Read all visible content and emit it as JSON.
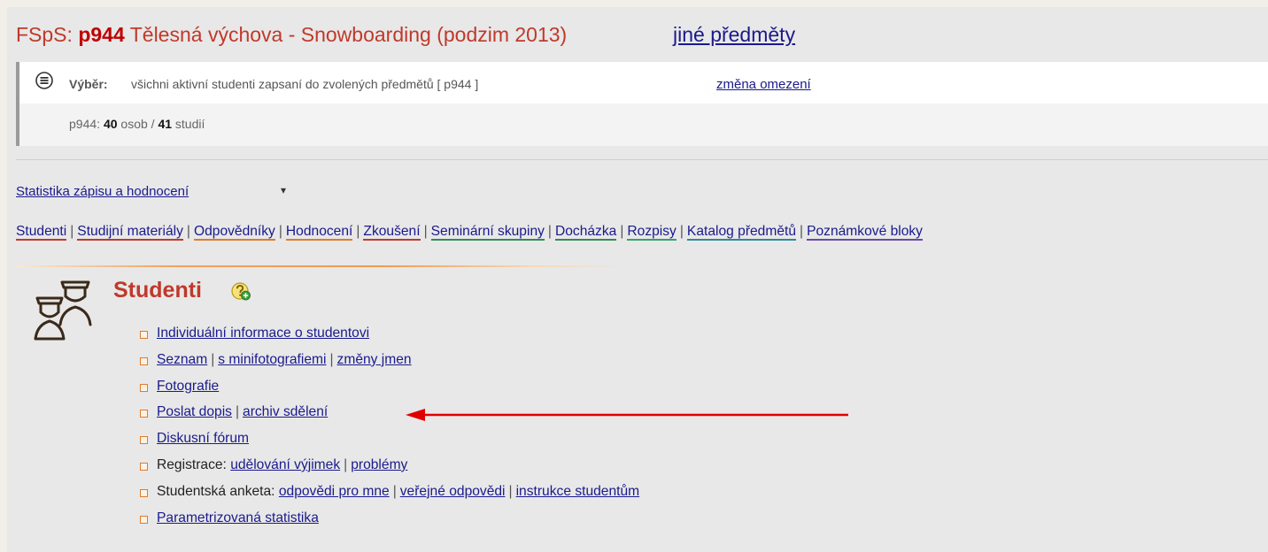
{
  "header": {
    "prefix": "FSpS: ",
    "course_code": "p944",
    "course_title": " Tělesná výchova - Snowboarding (podzim 2013)",
    "other_courses_link": "jiné předměty"
  },
  "selection": {
    "label": "Výběr:",
    "text": "všichni aktivní studenti zapsaní do zvolených předmětů [ p944 ]",
    "change_link": "změna omezení",
    "count_prefix": "p944: ",
    "persons": "40",
    "persons_label": " osob / ",
    "studies": "41",
    "studies_label": " studií"
  },
  "stats_link": "Statistika zápisu a hodnocení",
  "stats_caret": "▾",
  "nav": [
    {
      "label": "Studenti",
      "color": "#c0392b"
    },
    {
      "label": "Studijní materiály",
      "color": "#c0392b"
    },
    {
      "label": "Odpovědníky",
      "color": "#e07b2b"
    },
    {
      "label": "Hodnocení",
      "color": "#e07b2b"
    },
    {
      "label": "Zkoušení",
      "color": "#c0392b"
    },
    {
      "label": "Seminární skupiny",
      "color": "#2e8b57"
    },
    {
      "label": "Docházka",
      "color": "#2e8b57"
    },
    {
      "label": "Rozpisy",
      "color": "#33a36a"
    },
    {
      "label": "Katalog předmětů",
      "color": "#2a8a9a"
    },
    {
      "label": "Poznámkové bloky",
      "color": "#6a4aa0"
    }
  ],
  "section": {
    "title": "Studenti",
    "help_icon": "help-plus-icon",
    "students_icon": "students-icon"
  },
  "menu": {
    "m1": "Individuální informace o studentovi",
    "m2a": "Seznam",
    "m2b": "s minifotografiemi",
    "m2c": "změny jmen",
    "m3": "Fotografie",
    "m4a": "Poslat dopis",
    "m4b": "archiv sdělení",
    "m5": "Diskusní fórum",
    "m6label": "Registrace: ",
    "m6a": "udělování výjimek",
    "m6b": "problémy",
    "m7label": "Studentská anketa: ",
    "m7a": "odpovědi pro mne",
    "m7b": "veřejné odpovědi",
    "m7c": "instrukce studentům",
    "m8": "Parametrizovaná statistika",
    "separator": "|"
  },
  "colors": {
    "accent_red": "#c0392b",
    "link_blue": "#1a1a8c",
    "arrow_red": "#e00000"
  }
}
